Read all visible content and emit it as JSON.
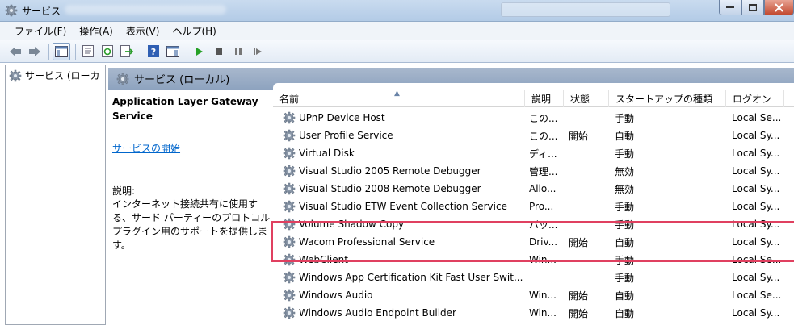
{
  "window": {
    "title": "サービス",
    "buttons": {
      "minimize": "minimize",
      "maximize": "maximize",
      "close": "close"
    }
  },
  "menu": {
    "items": [
      "ファイル(F)",
      "操作(A)",
      "表示(V)",
      "ヘルプ(H)"
    ]
  },
  "toolbar": {
    "icons": [
      "back-icon",
      "forward-icon",
      "console-tree-icon",
      "properties-icon",
      "refresh-icon",
      "export-icon",
      "help-icon",
      "view-icon",
      "start-icon",
      "stop-icon",
      "pause-icon",
      "restart-icon"
    ]
  },
  "tree": {
    "root_label": "サービス (ローカ"
  },
  "pane": {
    "title": "サービス (ローカル)"
  },
  "details": {
    "service_name": "Application Layer Gateway Service",
    "start_link": "サービスの開始",
    "description_label": "説明:",
    "description_text": "インターネット接続共有に使用す\nる、サード パーティーのプロトコル\nプラグイン用のサポートを提供しま\nす。"
  },
  "list": {
    "columns": {
      "name": "名前",
      "description": "説明",
      "status": "状態",
      "startup": "スタートアップの種類",
      "logon": "ログオン"
    },
    "rows": [
      {
        "name": "UPnP Device Host",
        "description": "この...",
        "status": "",
        "startup": "手動",
        "logon": "Local Se..."
      },
      {
        "name": "User Profile Service",
        "description": "この...",
        "status": "開始",
        "startup": "自動",
        "logon": "Local Sy..."
      },
      {
        "name": "Virtual Disk",
        "description": "ディ...",
        "status": "",
        "startup": "手動",
        "logon": "Local Sy..."
      },
      {
        "name": "Visual Studio 2005 Remote Debugger",
        "description": "管理...",
        "status": "",
        "startup": "無効",
        "logon": "Local Sy..."
      },
      {
        "name": "Visual Studio 2008 Remote Debugger",
        "description": "Allo...",
        "status": "",
        "startup": "無効",
        "logon": "Local Sy..."
      },
      {
        "name": "Visual Studio ETW Event Collection Service",
        "description": "Pro...",
        "status": "",
        "startup": "手動",
        "logon": "Local Sy..."
      },
      {
        "name": "Volume Shadow Copy",
        "description": "バッ...",
        "status": "",
        "startup": "手動",
        "logon": "Local Sy..."
      },
      {
        "name": "Wacom Professional Service",
        "description": "Driv...",
        "status": "開始",
        "startup": "自動",
        "logon": "Local Sy..."
      },
      {
        "name": "WebClient",
        "description": "Win...",
        "status": "",
        "startup": "手動",
        "logon": "Local Se..."
      },
      {
        "name": "Windows App Certification Kit Fast User Swit...",
        "description": "",
        "status": "",
        "startup": "手動",
        "logon": "Local Sy..."
      },
      {
        "name": "Windows Audio",
        "description": "Win...",
        "status": "開始",
        "startup": "自動",
        "logon": "Local Se..."
      },
      {
        "name": "Windows Audio Endpoint Builder",
        "description": "Win...",
        "status": "開始",
        "startup": "自動",
        "logon": "Local Sy..."
      }
    ]
  },
  "colors": {
    "highlight_border": "#e04060",
    "link": "#0066cc",
    "pane_header": "#8ea3bf"
  }
}
